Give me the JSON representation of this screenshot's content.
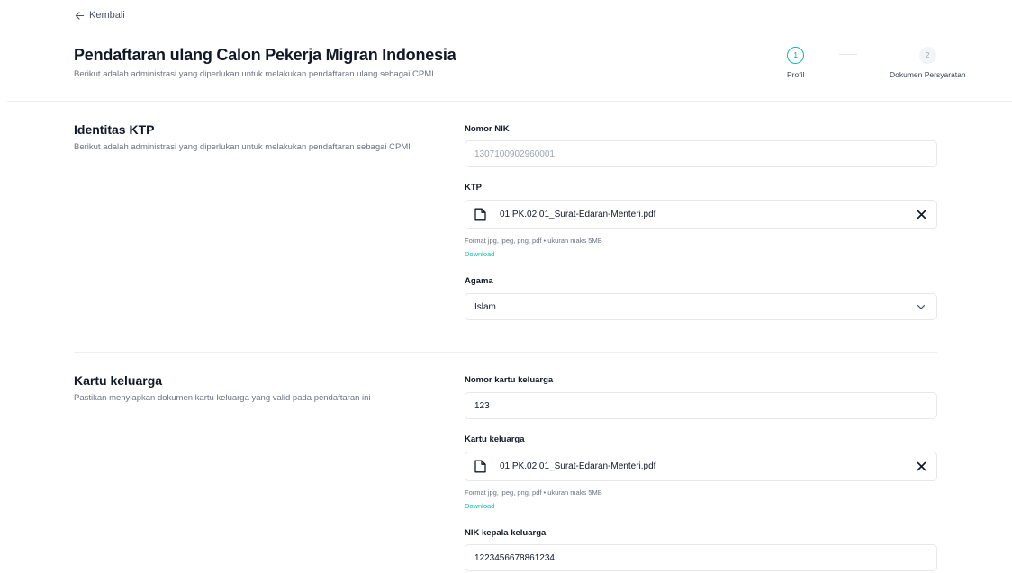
{
  "back": {
    "label": "Kembali"
  },
  "header": {
    "title": "Pendaftaran ulang Calon Pekerja Migran Indonesia",
    "subtitle": "Berikut adalah administrasi yang diperlukan untuk melakukan pendaftaran ulang sebagai CPMI."
  },
  "stepper": {
    "steps": [
      {
        "number": "1",
        "label": "Profil",
        "state": "active"
      },
      {
        "number": "2",
        "label": "Dokumen Persyaratan",
        "state": "inactive"
      }
    ]
  },
  "sections": {
    "ktp": {
      "title": "Identitas KTP",
      "description": "Berikut adalah administrasi yang diperlukan untuk melakukan pendaftaran sebagai CPMI",
      "nik": {
        "label": "Nomor NIK",
        "value": "1307100902960001"
      },
      "ktp_file": {
        "label": "KTP",
        "file_name": "01.PK.02.01_Surat-Edaran-Menteri.pdf",
        "hint": "Format jpg, jpeg, png, pdf • ukuran maks 5MB",
        "download": "Download"
      },
      "agama": {
        "label": "Agama",
        "value": "Islam"
      }
    },
    "kk": {
      "title": "Kartu keluarga",
      "description": "Pastikan menyiapkan dokumen kartu keluarga yang valid pada pendaftaran ini",
      "nomor_kk": {
        "label": "Nomor kartu keluarga",
        "value": "123"
      },
      "kk_file": {
        "label": "Kartu keluarga",
        "file_name": "01.PK.02.01_Surat-Edaran-Menteri.pdf",
        "hint": "Format jpg, jpeg, png, pdf • ukuran maks 5MB",
        "download": "Download"
      },
      "nik_kepala": {
        "label": "NIK kepala keluarga",
        "value": "1223456678861234"
      }
    }
  },
  "colors": {
    "accent": "#14b8a6",
    "border": "#e5e7eb",
    "muted_text": "#6b7280"
  },
  "icons": {
    "back": "arrow-left-icon",
    "file": "file-icon",
    "remove": "close-icon",
    "select": "chevron-down-icon"
  }
}
